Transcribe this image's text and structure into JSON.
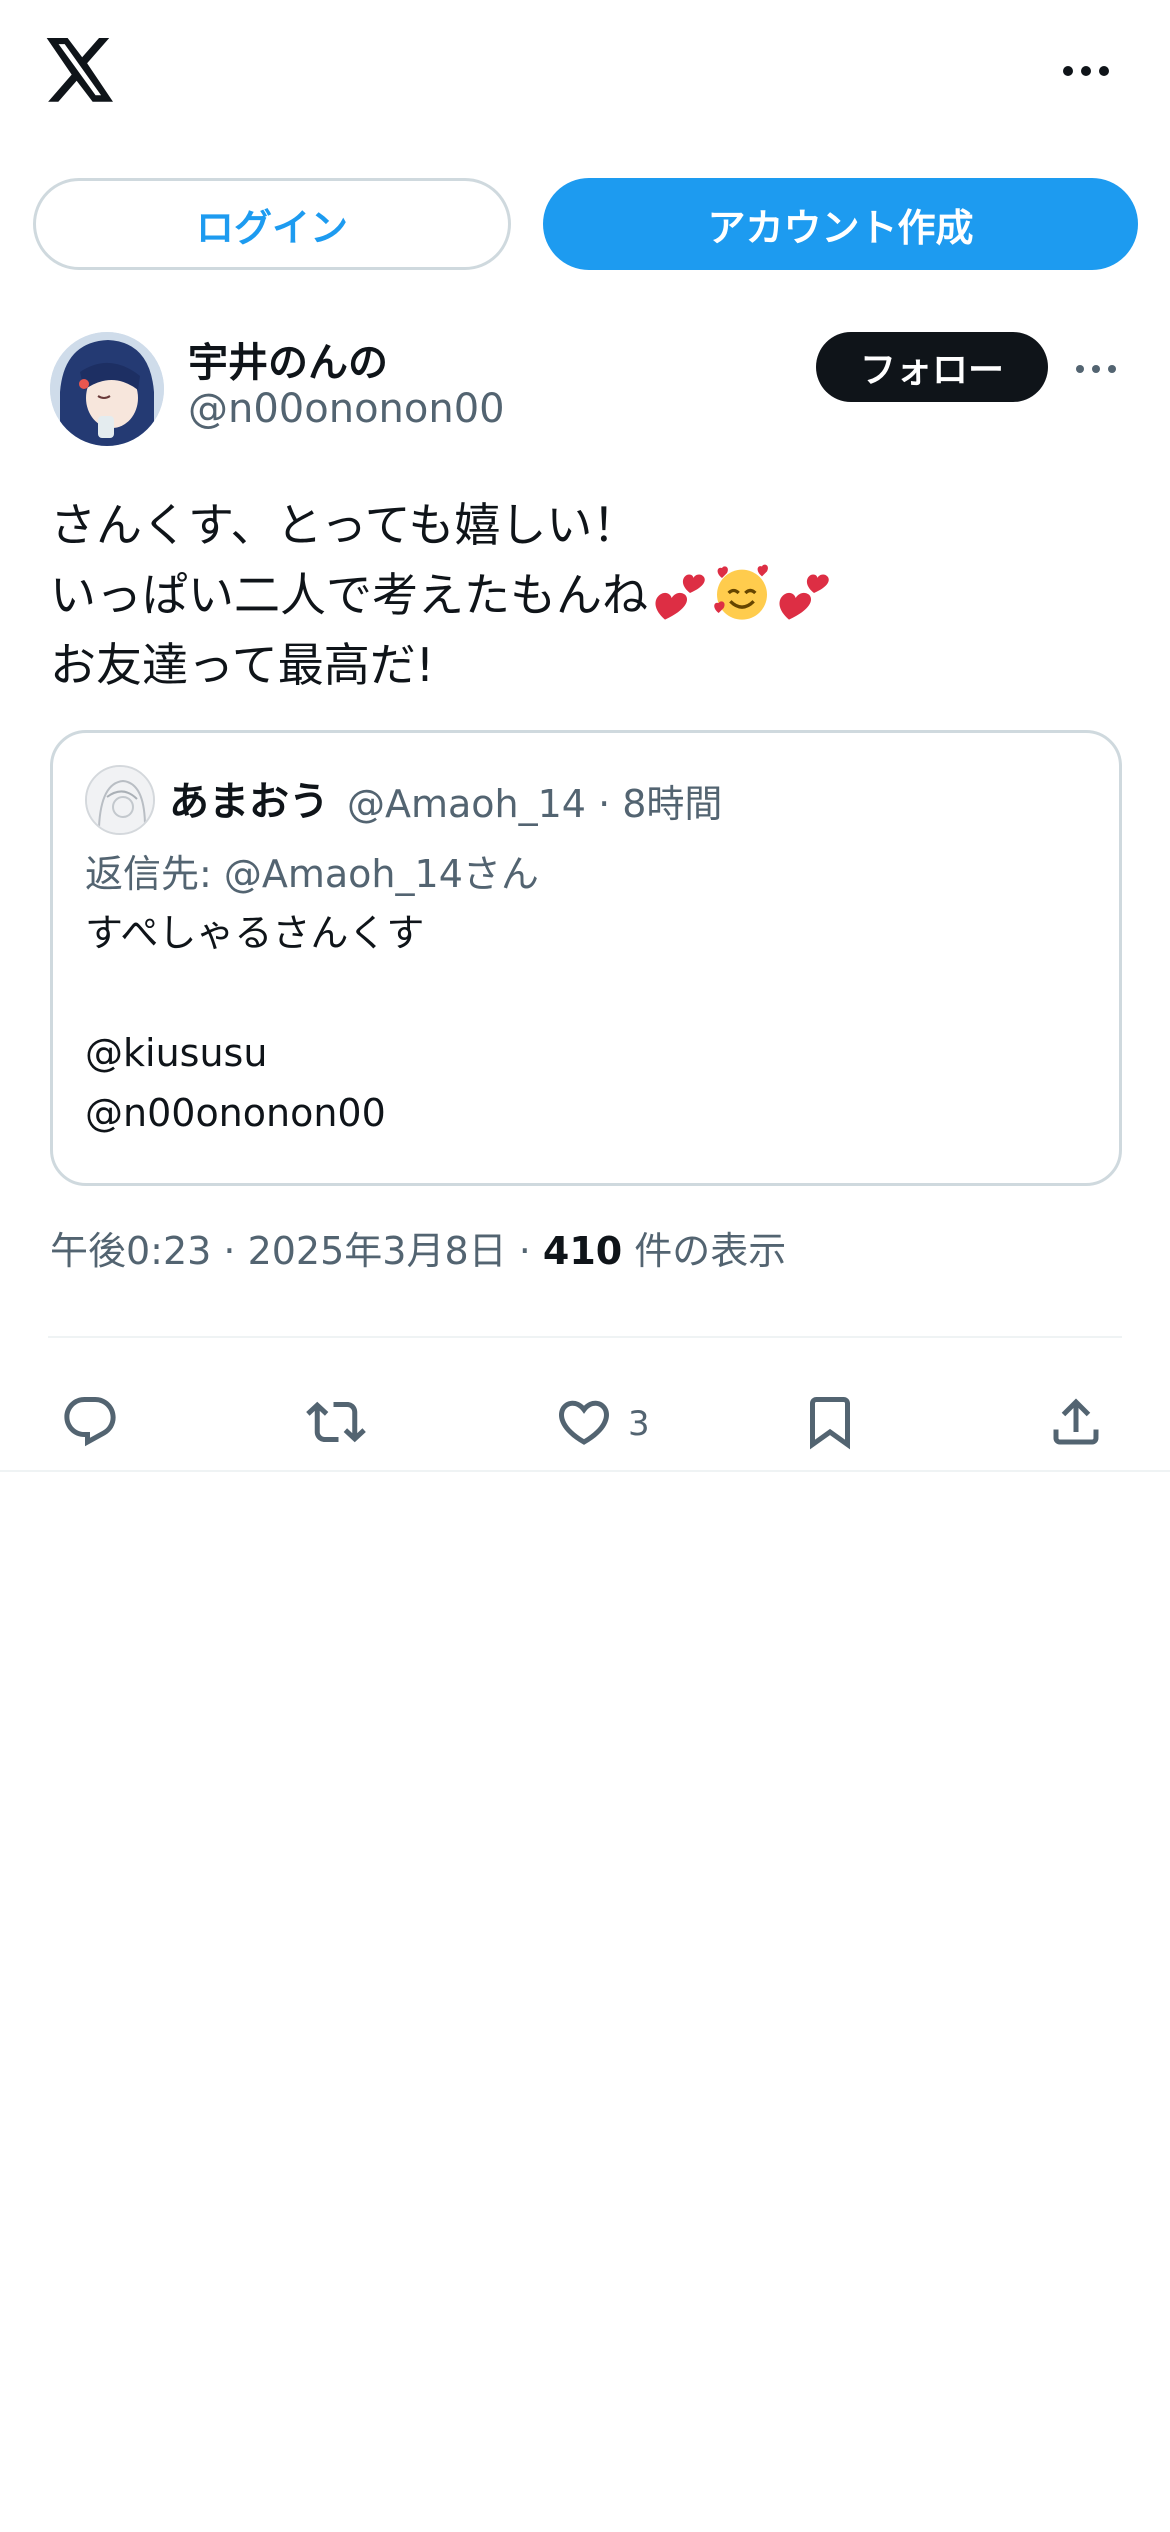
{
  "auth": {
    "login_label": "ログイン",
    "signup_label": "アカウント作成"
  },
  "tweet": {
    "display_name": "宇井のんの",
    "handle": "@n00ononon00",
    "follow_label": "フォロー",
    "text_lines": [
      "さんくす、とっても嬉しい！",
      "いっぱい二人で考えたもんね",
      "お友達って最高だ!"
    ],
    "emojis": [
      "two-hearts",
      "smiling-face-with-hearts",
      "two-hearts"
    ],
    "timestamp": "午後0:23 · 2025年3月8日 · ",
    "view_count": "410",
    "view_label": " 件の表示"
  },
  "quote": {
    "name": "あまおう",
    "handle": "@Amaoh_14",
    "separator": " · ",
    "time": "8時間",
    "reply_to": "返信先: @Amaoh_14さん",
    "body_lines": [
      "すぺしゃるさんくす",
      "",
      "@kiususu",
      "@n00ononon00"
    ]
  },
  "actions": {
    "like_count": "3"
  },
  "icons": [
    "x-logo-icon",
    "more-icon",
    "reply-icon",
    "retweet-icon",
    "like-icon",
    "bookmark-icon",
    "share-icon"
  ],
  "colors": {
    "accent": "#1d9bf0",
    "text": "#0f1419",
    "secondary": "#536471",
    "border": "#cfd9de"
  }
}
